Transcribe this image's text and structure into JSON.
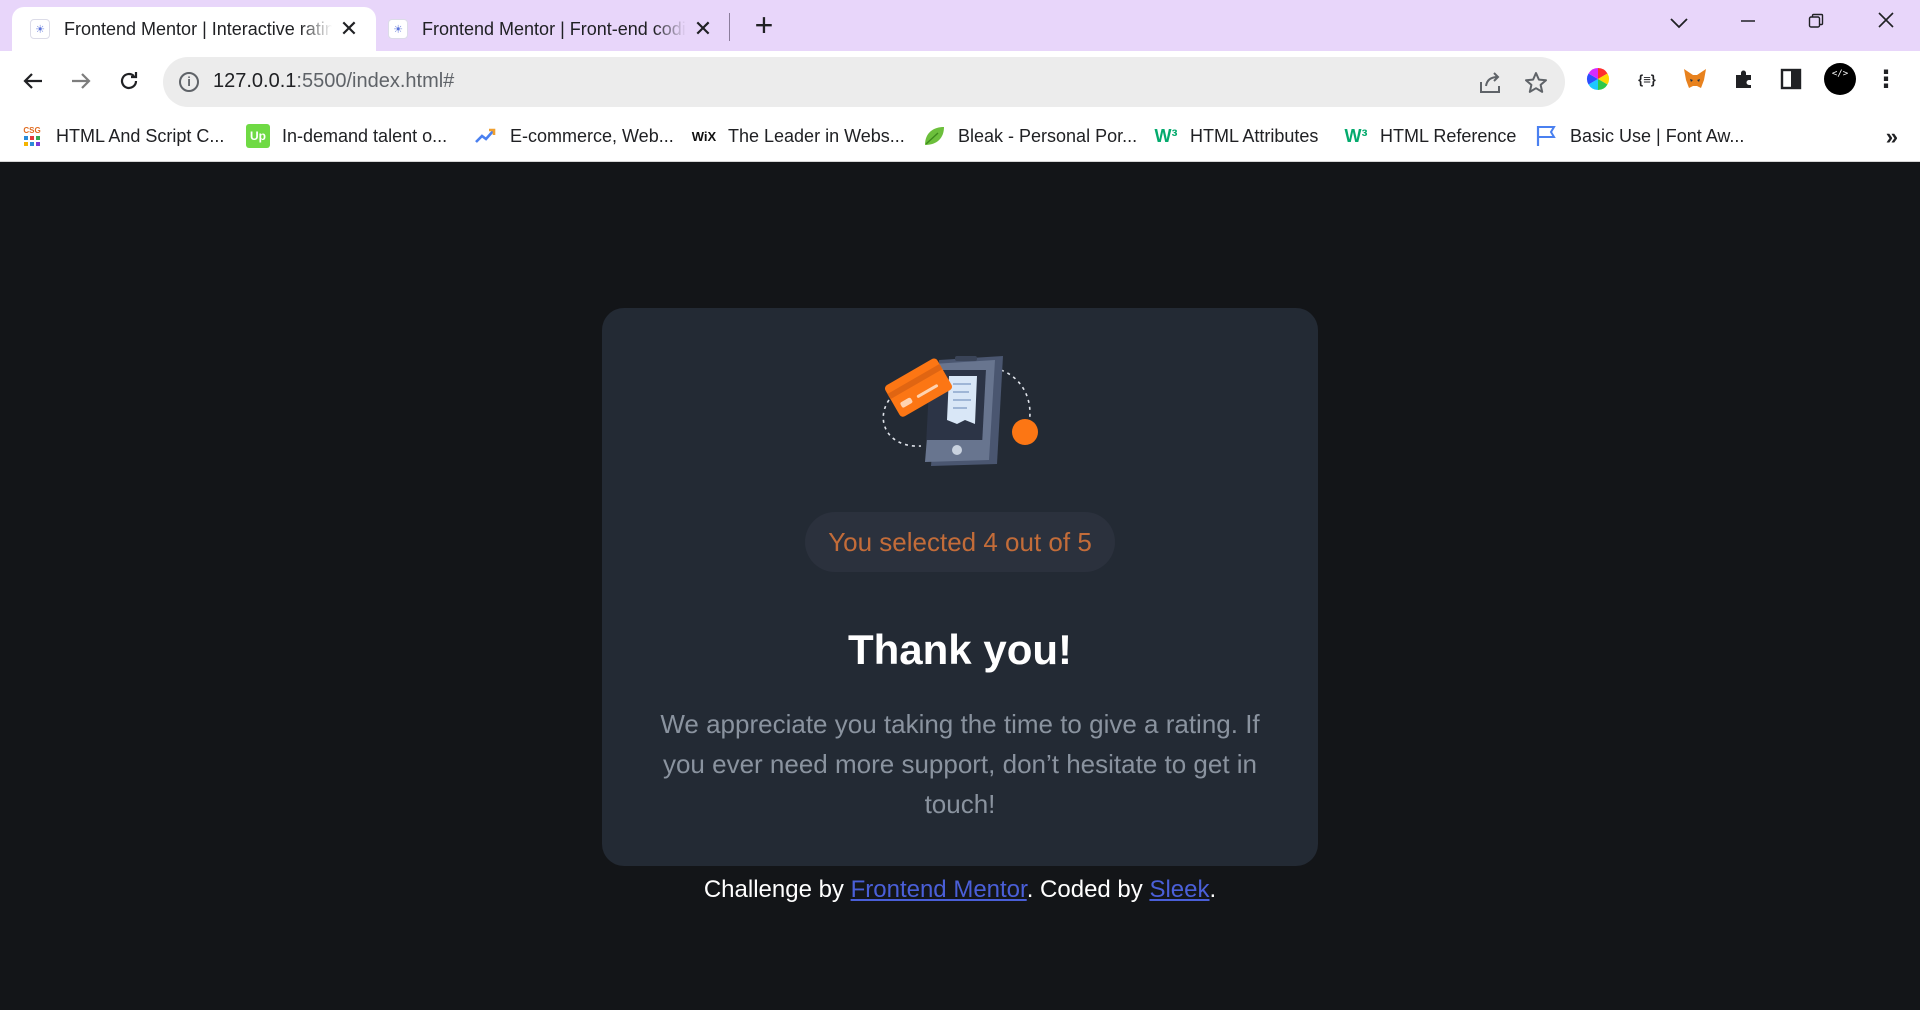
{
  "tabs": [
    {
      "title": "Frontend Mentor | Interactive rating component",
      "favicon": "frontend-mentor-icon",
      "active": true
    },
    {
      "title": "Frontend Mentor | Front-end coding challenges",
      "favicon": "frontend-mentor-icon",
      "active": false
    }
  ],
  "toolbar": {
    "url_host": "127.0.0.1",
    "url_rest": ":5500/index.html#"
  },
  "bookmarks": [
    {
      "label": "HTML And Script C...",
      "icon": "csg-icon"
    },
    {
      "label": "In-demand talent o...",
      "icon": "upwork-icon"
    },
    {
      "label": "E-commerce, Web...",
      "icon": "trend-icon"
    },
    {
      "label": "The Leader in Webs...",
      "icon": "wix-icon"
    },
    {
      "label": "Bleak - Personal Por...",
      "icon": "leaf-icon"
    },
    {
      "label": "HTML Attributes",
      "icon": "w3schools-icon"
    },
    {
      "label": "HTML Reference",
      "icon": "w3schools-icon"
    },
    {
      "label": "Basic Use | Font Aw...",
      "icon": "flag-icon"
    }
  ],
  "bookmarks_more": "»",
  "card": {
    "selection_text": "You selected 4 out of 5",
    "title": "Thank you!",
    "message": "We appreciate you taking the time to give a rating. If you ever need more support, don’t hesitate to get in touch!"
  },
  "attribution": {
    "prefix": "Challenge by ",
    "link1": "Frontend Mentor",
    "middle": ". Coded by ",
    "link2": "Sleek",
    "suffix": "."
  },
  "colors": {
    "accent": "#fc7614",
    "page_bg": "#131518",
    "card_bg": "#232a34",
    "tabstrip_bg": "#e8d6fa"
  }
}
